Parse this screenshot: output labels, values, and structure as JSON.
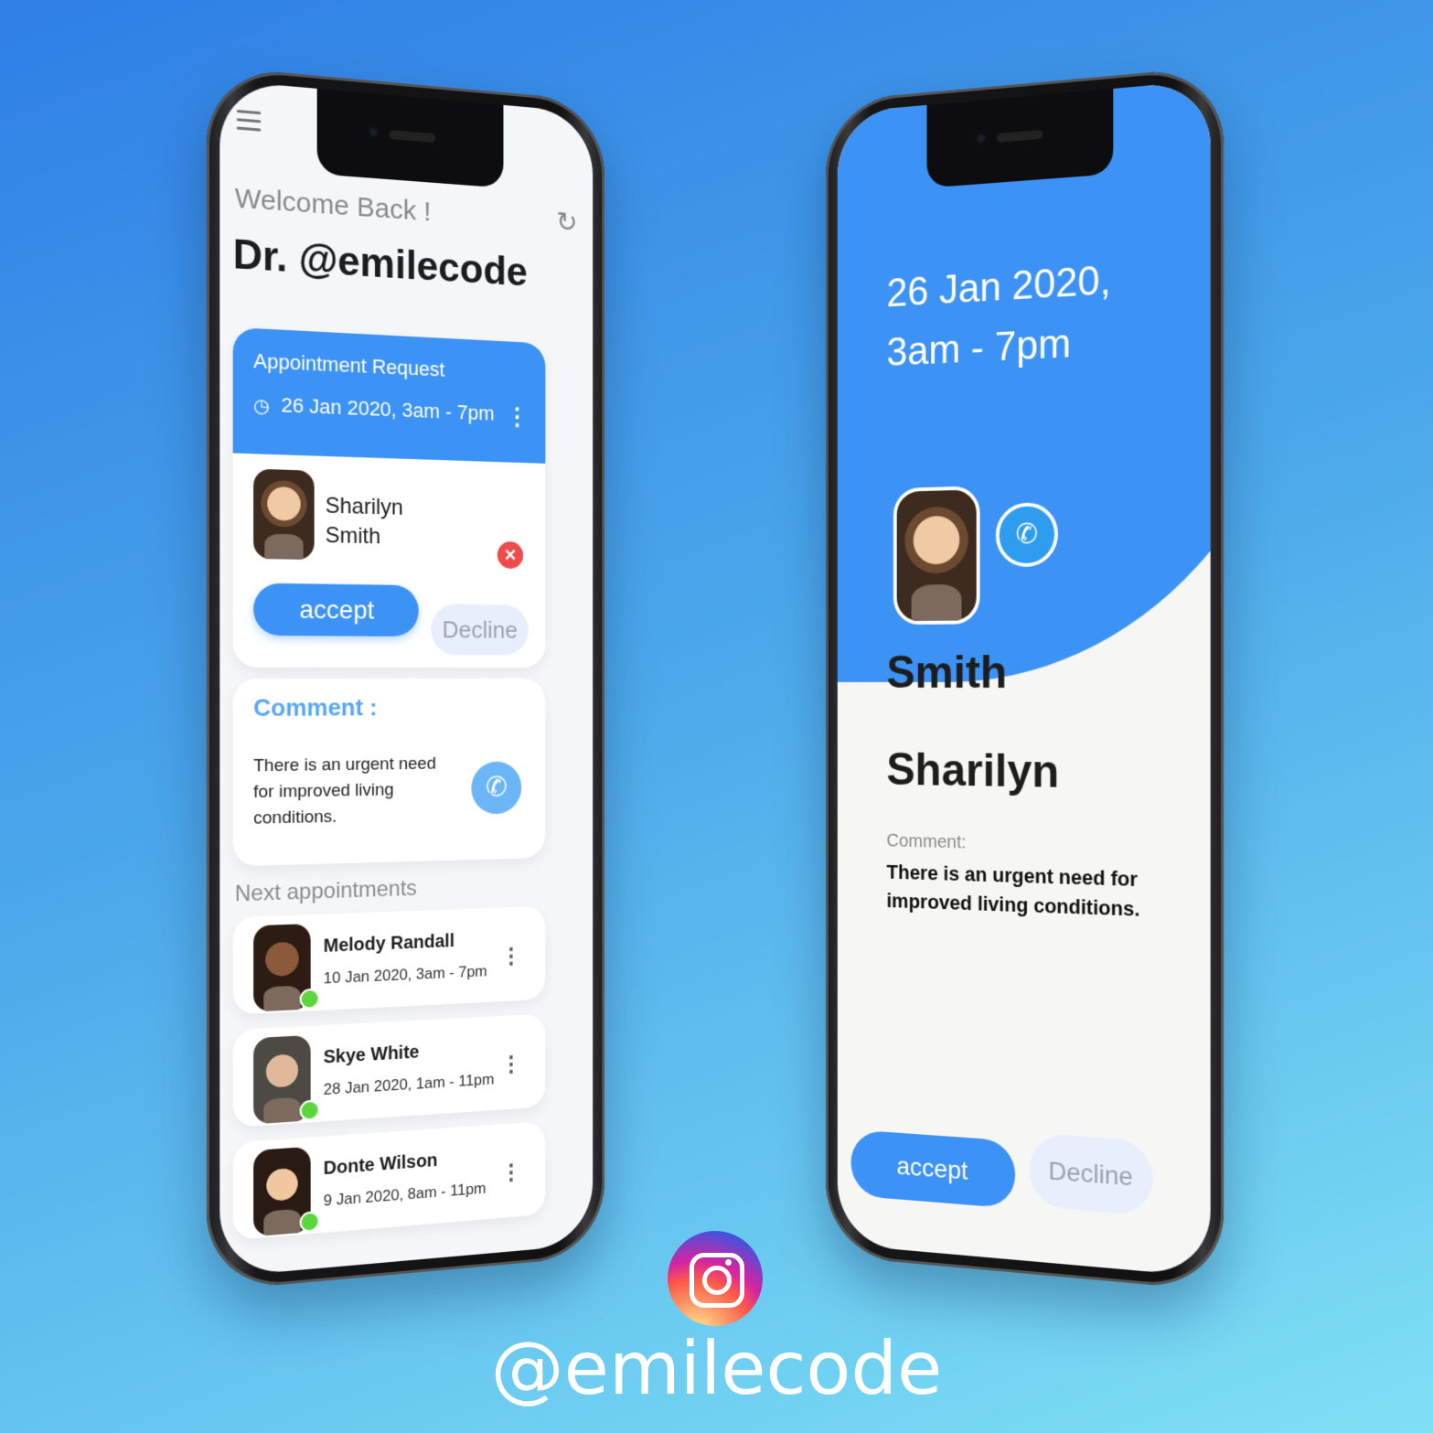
{
  "left_screen": {
    "welcome": "Welcome Back !",
    "doctor_name": "Dr. @emilecode",
    "request_card": {
      "title": "Appointment Request",
      "datetime": "26 Jan 2020, 3am - 7pm",
      "patient_first": "Sharilyn",
      "patient_last": "Smith",
      "accept_label": "accept",
      "decline_label": "Decline"
    },
    "comment_card": {
      "label": "Comment :",
      "text": "There is an urgent need for improved living conditions."
    },
    "next_title": "Next appointments",
    "appointments": [
      {
        "name": "Melody Randall",
        "time": "10 Jan 2020, 3am - 7pm"
      },
      {
        "name": "Skye White",
        "time": "28 Jan 2020, 1am - 11pm"
      },
      {
        "name": "Donte Wilson",
        "time": "9 Jan 2020, 8am - 11pm"
      }
    ]
  },
  "right_screen": {
    "date_line1": "26 Jan 2020,",
    "date_line2": "3am - 7pm",
    "last_name": "Smith",
    "first_name": "Sharilyn",
    "comment_label": "Comment:",
    "comment_text": "There is an urgent need for improved living conditions.",
    "accept_label": "accept",
    "decline_label": "Decline"
  },
  "brand": {
    "handle": "@emilecode",
    "icon": "instagram-icon"
  },
  "colors": {
    "primary": "#3d93f5",
    "decline_bg": "#e8eefb",
    "online": "#5bd63c",
    "reject": "#ef4b4b"
  },
  "icons": {
    "menu": "menu-icon",
    "refresh": "refresh-icon",
    "clock": "clock-icon",
    "more": "more-vertical-icon",
    "close": "close-icon",
    "phone": "phone-icon"
  }
}
